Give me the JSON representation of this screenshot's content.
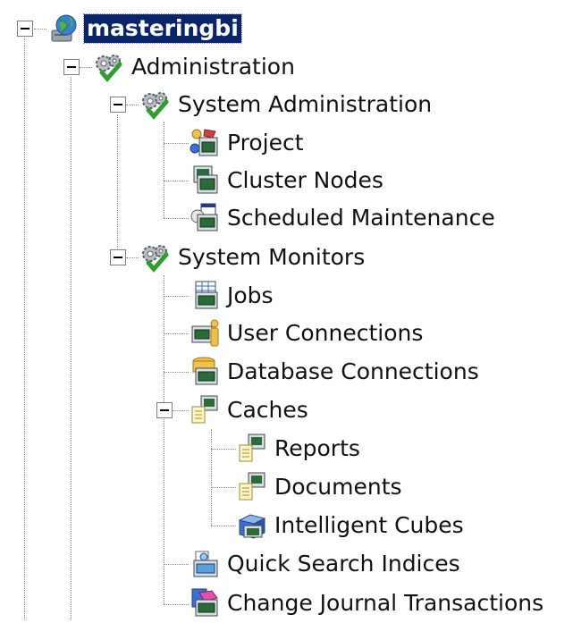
{
  "tree": {
    "root": {
      "label": "masteringbi",
      "icon": "server-globe-icon",
      "expanded": true,
      "selected": true
    },
    "administration": {
      "label": "Administration",
      "icon": "gears-check-icon",
      "expanded": true
    },
    "system_administration": {
      "label": "System Administration",
      "icon": "gears-check-icon",
      "expanded": true,
      "items": [
        {
          "label": "Project",
          "icon": "project-icon"
        },
        {
          "label": "Cluster Nodes",
          "icon": "cluster-nodes-icon"
        },
        {
          "label": "Scheduled Maintenance",
          "icon": "scheduled-maintenance-icon"
        }
      ]
    },
    "system_monitors": {
      "label": "System Monitors",
      "icon": "gears-check-icon",
      "expanded": true,
      "items": [
        {
          "label": "Jobs",
          "icon": "jobs-icon"
        },
        {
          "label": "User Connections",
          "icon": "user-connections-icon"
        },
        {
          "label": "Database Connections",
          "icon": "database-connections-icon"
        }
      ],
      "caches": {
        "label": "Caches",
        "icon": "caches-icon",
        "expanded": true,
        "items": [
          {
            "label": "Reports",
            "icon": "reports-cache-icon"
          },
          {
            "label": "Documents",
            "icon": "documents-cache-icon"
          },
          {
            "label": "Intelligent Cubes",
            "icon": "intelligent-cubes-icon"
          }
        ]
      },
      "items_after": [
        {
          "label": "Quick Search Indices",
          "icon": "quick-search-icon"
        },
        {
          "label": "Change Journal Transactions",
          "icon": "change-journal-icon"
        }
      ]
    }
  },
  "colors": {
    "selection": "#0a246a",
    "check": "#2e9e2e",
    "screen": "#2b6b3a"
  }
}
